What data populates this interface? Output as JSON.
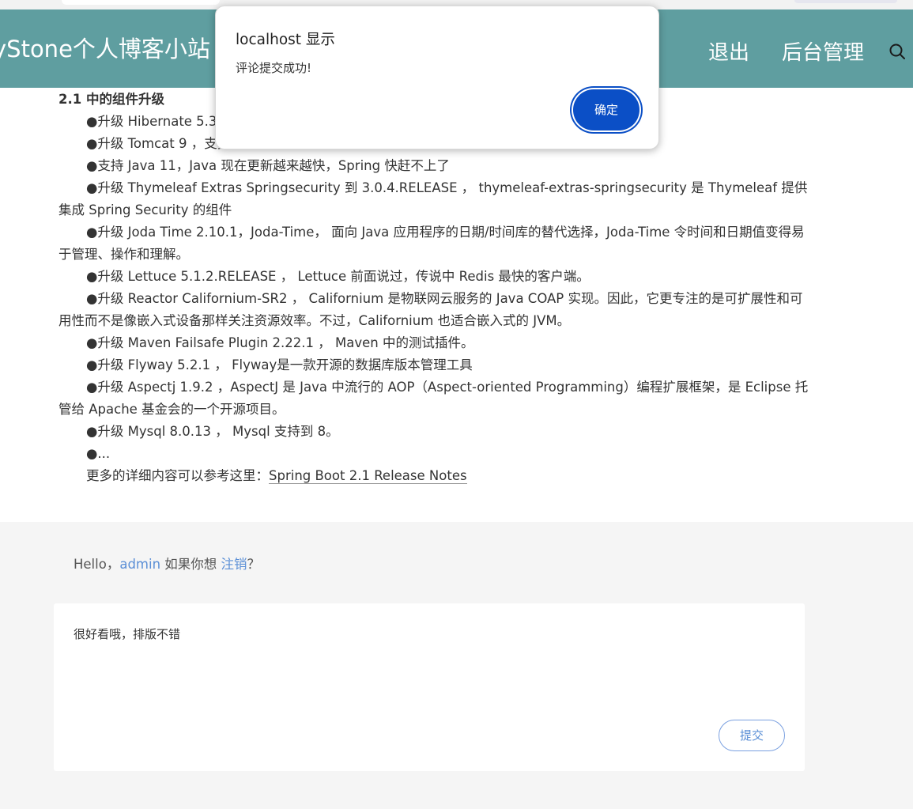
{
  "browser": {},
  "header": {
    "site_title": "yStone个人博客小站",
    "nav": {
      "logout": "退出",
      "admin": "后台管理"
    },
    "search_icon": "search-icon",
    "background_color": "#5f9ea0"
  },
  "article": {
    "heading": "2.1 中的组件升级",
    "items": [
      "●升级 Hibernate 5.3，",
      "●升级 Tomcat 9 ，支持最新的 Tomcat 9",
      "●支持 Java 11，Java 现在更新越来越快，Spring 快赶不上了",
      "●升级 Thymeleaf Extras Springsecurity 到 3.0.4.RELEASE ， thymeleaf-extras-springsecurity 是 Thymeleaf 提供集成 Spring Security 的组件",
      "●升级 Joda Time 2.10.1，Joda-Time， 面向 Java 应用程序的日期/时间库的替代选择，Joda-Time 令时间和日期值变得易于管理、操作和理解。",
      "●升级 Lettuce 5.1.2.RELEASE ， Lettuce 前面说过，传说中 Redis 最快的客户端。",
      "●升级 Reactor Californium-SR2 ， Californium 是物联网云服务的 Java COAP 实现。因此，它更专注的是可扩展性和可用性而不是像嵌入式设备那样关注资源效率。不过，Californium 也适合嵌入式的 JVM。",
      "●升级 Maven Failsafe Plugin 2.22.1 ， Maven 中的测试插件。",
      "●升级 Flyway 5.2.1 ， Flyway是一款开源的数据库版本管理工具",
      "●升级 Aspectj 1.9.2 ，AspectJ 是 Java 中流行的 AOP（Aspect-oriented Programming）编程扩展框架，是 Eclipse 托管给 Apache 基金会的一个开源项目。",
      "●升级 Mysql 8.0.13 ， Mysql 支持到 8。",
      "●..."
    ],
    "more_prefix": "更多的详细内容可以参考这里：",
    "more_link": "Spring Boot 2.1 Release Notes"
  },
  "comments": {
    "hello_prefix": "Hello，",
    "username": "admin",
    "hello_middle": " 如果你想 ",
    "logout_link": "注销",
    "hello_suffix": "？",
    "comment_value": "很好看哦，排版不错",
    "submit_label": "提交"
  },
  "dialog": {
    "title": "localhost 显示",
    "message": "评论提交成功!",
    "ok_label": "确定",
    "ok_color": "#0b4fc6"
  }
}
